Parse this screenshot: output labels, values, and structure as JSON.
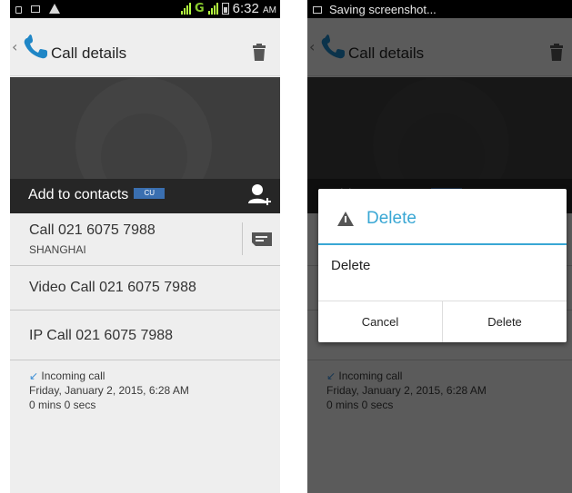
{
  "status_bar": {
    "time": "6:32",
    "ampm": "AM",
    "network": "G"
  },
  "notification": {
    "text": "Saving screenshot..."
  },
  "action_bar": {
    "title": "Call details"
  },
  "add_contacts": {
    "label": "Add to contacts",
    "badge": "CU"
  },
  "entries": [
    {
      "main": "Call 021 6075 7988",
      "sub": "SHANGHAI"
    },
    {
      "main": "Video Call 021 6075 7988"
    },
    {
      "main": "IP Call 021 6075 7988"
    }
  ],
  "history": {
    "type": "Incoming call",
    "date": "Friday, January 2, 2015, 6:28 AM",
    "duration": "0 mins 0 secs"
  },
  "dialog": {
    "title": "Delete",
    "message": "Delete",
    "cancel": "Cancel",
    "confirm": "Delete"
  },
  "colors": {
    "accent": "#39a7d4",
    "signal": "#b3ff3f",
    "incoming_arrow": "#3d8fd6"
  }
}
